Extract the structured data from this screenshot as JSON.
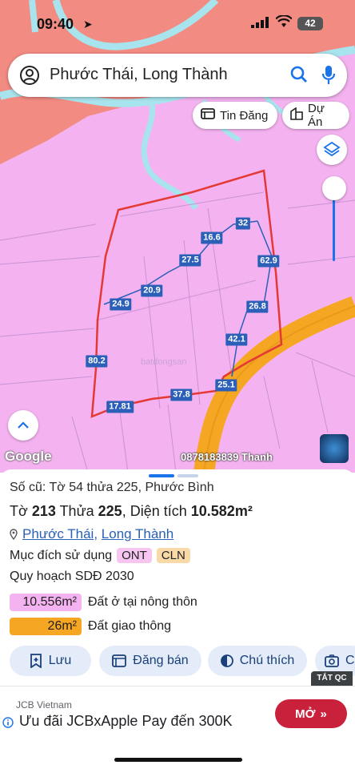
{
  "status_bar": {
    "time": "09:40",
    "battery": "42"
  },
  "search": {
    "query": "Phước Thái, Long Thành"
  },
  "map": {
    "chips": {
      "listings": "Tin Đăng",
      "projects": "Dự Án"
    },
    "google": "Google",
    "contact": "0878183839 Thanh",
    "watermark": "batdongsan",
    "edge_labels": [
      "32",
      "16.6",
      "27.5",
      "20.9",
      "24.9",
      "62.9",
      "26.8",
      "42.1",
      "80.2",
      "17.81",
      "37.8",
      "25.1"
    ]
  },
  "info": {
    "old_ref": "Số cũ: Tờ 54 thửa 225, Phước Bình",
    "sheet_label": "Tờ",
    "sheet_no": "213",
    "parcel_label": "Thửa",
    "parcel_no": "225",
    "area_label": ", Diện tích",
    "area_value": "10.582m²",
    "ward": "Phước Thái",
    "separator": ",",
    "district": "Long Thành",
    "purpose_label": "Mục đích sử dụng",
    "purpose_tags": [
      "ONT",
      "CLN"
    ],
    "plan_label": "Quy hoạch SDĐ 2030",
    "zones": [
      {
        "area": "10.556m²",
        "label": "Đất ở tại nông thôn",
        "color": "#f4b3f0"
      },
      {
        "area": "26m²",
        "label": "Đất giao thông",
        "color": "#f5a623"
      }
    ]
  },
  "actions": {
    "save": "Lưu",
    "post": "Đăng bán",
    "legend": "Chú thích",
    "capture": "C"
  },
  "ad": {
    "close_label": "TẮT QC",
    "advertiser": "JCB Vietnam",
    "headline": "Ưu đãi JCBxApple Pay đến 300K",
    "cta": "MỞ"
  },
  "colors": {
    "land": "#f4b3f0",
    "river_bank": "#f28b82",
    "water": "#a8e4ee",
    "road": "#f5a623",
    "parcel_border": "#e53935",
    "accent": "#1a73e8"
  }
}
